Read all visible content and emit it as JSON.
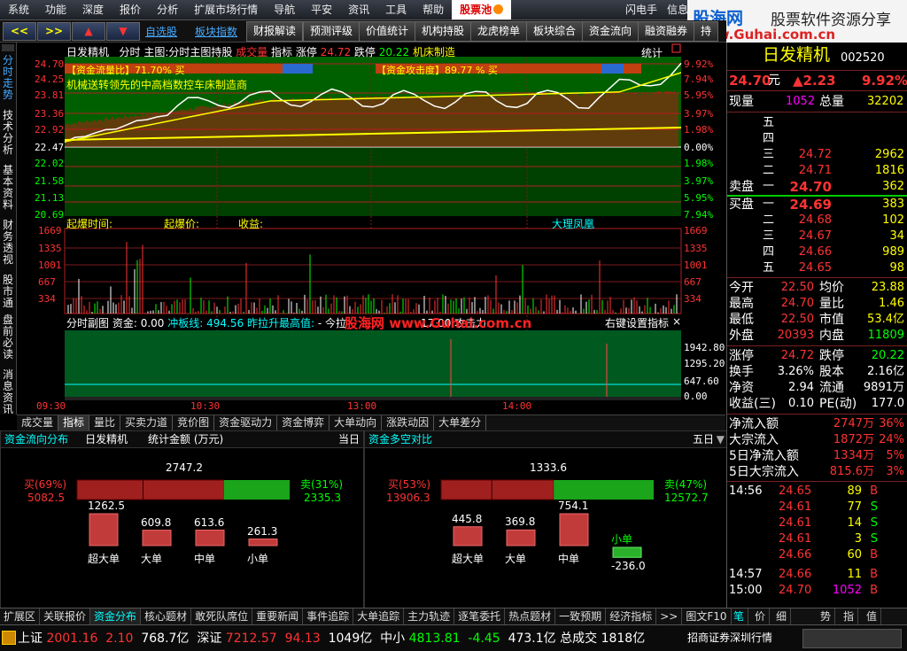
{
  "menu": [
    "系统",
    "功能",
    "深度",
    "报价",
    "分析",
    "扩展市场行情",
    "导航",
    "平安",
    "资讯",
    "工具",
    "帮助"
  ],
  "menu_hl": "股票池",
  "menu_right": [
    "闪电手",
    "信息",
    "行"
  ],
  "toolbar": {
    "left_arrow": "<<",
    "right_arrow": ">>",
    "up": "▲",
    "down": "▼",
    "link1": "自选股",
    "link2": "板块指数",
    "buttons": [
      "财报解读",
      "预测评级",
      "价值统计",
      "机构持股",
      "龙虎榜单",
      "板块综合",
      "资金流向",
      "融资融券",
      "持"
    ]
  },
  "logo": {
    "brand": "股海网",
    "slogan": "股票软件资源分享",
    "url": "www.Guhai.com.cn"
  },
  "left_tabs": [
    "分时走势",
    "技术分析",
    "基本资料",
    "财务透视",
    "股市通",
    "盘前必读",
    "消息资讯"
  ],
  "chart_header": {
    "name": "日发精机",
    "t1": "分时",
    "t2": "主图:分时主图持股",
    "t3": "成交量",
    "t4": "指标",
    "zt_label": "涨停",
    "zt": "24.72",
    "dt_label": "跌停",
    "dt": "20.22",
    "sector": "机床制造",
    "stat": "统计"
  },
  "banner1": "【资金流量比】71.70% 买",
  "banner2": "【资金攻击度】89.77 % 买",
  "concept": "机械送转领先的中高档数控车床制造商",
  "price_axis": [
    "24.70",
    "24.25",
    "23.81",
    "23.36",
    "22.92",
    "22.47",
    "22.02",
    "21.58",
    "21.13",
    "20.69"
  ],
  "pct_axis": [
    "9.92%",
    "7.94%",
    "5.95%",
    "3.97%",
    "1.98%",
    "0.00%",
    "1.98%",
    "3.97%",
    "5.95%",
    "7.94%"
  ],
  "vol_axis": [
    "1669",
    "1335",
    "1001",
    "667",
    "334"
  ],
  "info_line": {
    "a": "起爆时间:",
    "b": "起爆价:",
    "c": "收益:",
    "d": "大理凤凰"
  },
  "sub_header": {
    "a": "分时副图",
    "b": "资金: 0.00",
    "c": "冲板线: 494.56",
    "d": "昨拉升最高值:",
    "e": "- 今拉",
    "f": "17.00 攻击力:",
    "g": "右键设置指标",
    "x": "×"
  },
  "sub_axis": [
    "1942.80",
    "1295.20",
    "647.60",
    "0.00"
  ],
  "watermark": "股海网 www.Guhai.com.cn",
  "times": [
    "09:30",
    "10:30",
    "13:00",
    "14:00"
  ],
  "tabs2": [
    "成交量",
    "指标",
    "量比",
    "买卖力道",
    "竞价图",
    "资金驱动力",
    "资金博弈",
    "大单动向",
    "涨跌动因",
    "大单差分"
  ],
  "flow": {
    "title": "资金流向分布",
    "name": "日发精机",
    "unit": "统计金额 (万元)",
    "period": "当日",
    "buy_label": "买(69%)",
    "buy_val": "5082.5",
    "net": "2747.2",
    "sell_label": "卖(31%)",
    "sell_val": "2335.3",
    "buy_frac": 0.69,
    "bars": [
      {
        "label": "超大单",
        "value": "1262.5",
        "v": 1262.5
      },
      {
        "label": "大单",
        "value": "609.8",
        "v": 609.8
      },
      {
        "label": "中单",
        "value": "613.6",
        "v": 613.6
      },
      {
        "label": "小单",
        "value": "261.3",
        "v": 261.3
      }
    ]
  },
  "ls": {
    "title": "资金多空对比",
    "period": "五日",
    "buy_label": "买(53%)",
    "buy_val": "13906.3",
    "net": "1333.6",
    "sell_label": "卖(47%)",
    "sell_val": "12572.7",
    "buy_frac": 0.53,
    "bars": [
      {
        "label": "超大单",
        "value": "445.8",
        "v": 445.8
      },
      {
        "label": "大单",
        "value": "369.8",
        "v": 369.8
      },
      {
        "label": "中单",
        "value": "754.1",
        "v": 754.1
      },
      {
        "label": "小单",
        "value": "-236.0",
        "v": -236.0
      }
    ]
  },
  "bottom_tabs": [
    "扩展区",
    "关联报价",
    "资金分布",
    "核心题材",
    "敢死队席位",
    "重要新闻",
    "事件追踪",
    "大单追踪",
    "主力轨迹",
    "逐笔委托",
    "热点题材",
    "一致预期",
    "经济指标",
    ">>",
    "图文F10"
  ],
  "right_bottom_tabs": [
    "笔",
    "价",
    "细",
    "势",
    "指",
    "值"
  ],
  "quote": {
    "name": "日发精机",
    "code": "002520",
    "price": "24.70",
    "unit": "元",
    "chg": "▲2.23",
    "pct": "9.92%",
    "xianliang_label": "现量",
    "xianliang": "1052",
    "zongliang_label": "总量",
    "zongliang": "32202",
    "sells": [
      {
        "l": "五",
        "p": "",
        "v": ""
      },
      {
        "l": "四",
        "p": "",
        "v": ""
      },
      {
        "l": "三",
        "p": "24.72",
        "v": "2962"
      },
      {
        "l": "二",
        "p": "24.71",
        "v": "1816"
      },
      {
        "l": "一",
        "p": "24.70",
        "v": "362"
      }
    ],
    "sell_title": "卖盘",
    "buy_title": "买盘",
    "buys": [
      {
        "l": "一",
        "p": "24.69",
        "v": "383"
      },
      {
        "l": "二",
        "p": "24.68",
        "v": "102"
      },
      {
        "l": "三",
        "p": "24.67",
        "v": "34"
      },
      {
        "l": "四",
        "p": "24.66",
        "v": "989"
      },
      {
        "l": "五",
        "p": "24.65",
        "v": "98"
      }
    ],
    "stats": [
      {
        "a": "今开",
        "av": "22.50",
        "b": "均价",
        "bv": "23.88"
      },
      {
        "a": "最高",
        "av": "24.70",
        "b": "量比",
        "bv": "1.46"
      },
      {
        "a": "最低",
        "av": "22.50",
        "b": "市值",
        "bv": "53.4亿"
      },
      {
        "a": "外盘",
        "av": "20393",
        "b": "内盘",
        "bv": "11809"
      }
    ],
    "stats2": [
      {
        "a": "涨停",
        "av": "24.72",
        "b": "跌停",
        "bv": "20.22"
      },
      {
        "a": "换手",
        "av": "3.26%",
        "b": "股本",
        "bv": "2.16亿"
      },
      {
        "a": "净资",
        "av": "2.94",
        "b": "流通",
        "bv": "9891万"
      },
      {
        "a": "收益(三)",
        "av": "0.10",
        "b": "PE(动)",
        "bv": "177.0"
      }
    ],
    "flows": [
      {
        "a": "净流入额",
        "v": "2747万",
        "p": "36%"
      },
      {
        "a": "大宗流入",
        "v": "1872万",
        "p": "24%"
      },
      {
        "a": "5日净流入额",
        "v": "1334万",
        "p": "5%"
      },
      {
        "a": "5日大宗流入",
        "v": "815.6万",
        "p": "3%"
      }
    ],
    "ticks": [
      {
        "t": "14:56",
        "p": "24.65",
        "v": "89",
        "s": "B"
      },
      {
        "t": "",
        "p": "24.61",
        "v": "77",
        "s": "S"
      },
      {
        "t": "",
        "p": "24.61",
        "v": "14",
        "s": "S"
      },
      {
        "t": "",
        "p": "24.61",
        "v": "3",
        "s": "S"
      },
      {
        "t": "",
        "p": "24.66",
        "v": "60",
        "s": "B"
      },
      {
        "t": "14:57",
        "p": "24.66",
        "v": "11",
        "s": "B"
      },
      {
        "t": "15:00",
        "p": "24.70",
        "v": "1052",
        "s": "B"
      }
    ]
  },
  "status": {
    "sh_label": "上证",
    "sh": "2001.16",
    "sh_chg": "2.10",
    "sh_amt": "768.7亿",
    "sz_label": "深证",
    "sz": "7212.57",
    "sz_chg": "94.13",
    "sz_amt": "1049亿",
    "zx_label": "中小",
    "zx": "4813.81",
    "zx_chg": "-4.45",
    "zx_amt": "473.1亿",
    "total_label": "总成交",
    "total": "1818亿",
    "broker": "招商证券深圳行情"
  },
  "colors": {
    "up": "#ff3333",
    "down": "#00ff00",
    "accent": "#ffff00"
  }
}
